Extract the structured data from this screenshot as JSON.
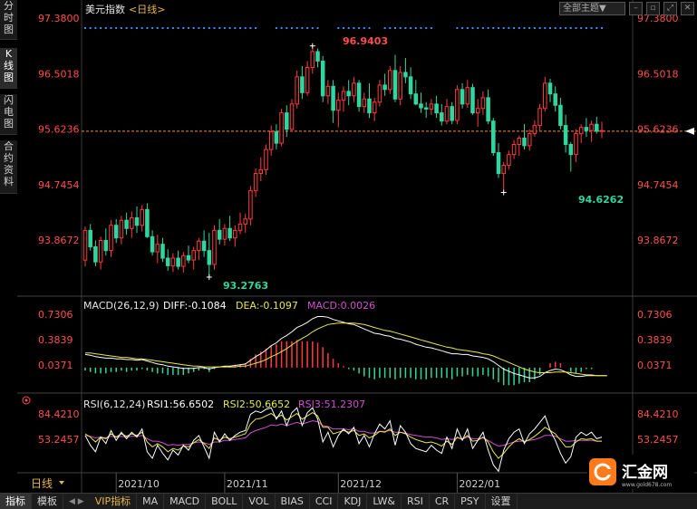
{
  "sidebar_tabs": [
    {
      "label": "分时图"
    },
    {
      "label": "K线图",
      "active": true
    },
    {
      "label": "闪电图"
    },
    {
      "label": "合约资料"
    }
  ],
  "toolbar": {
    "theme": "全部主题▼",
    "icons": [
      "minus-icon",
      "restore-icon",
      "expand-icon",
      "close-icon"
    ]
  },
  "price_panel": {
    "symbol": "美元指数",
    "period_tag": "<日线>",
    "axis_labels": [
      "97.3800",
      "96.5018",
      "95.6236",
      "94.7454",
      "93.8672"
    ],
    "ref_level": 95.59,
    "annotations": {
      "high": "96.9403",
      "low": "93.2763",
      "recent_low": "94.6262"
    }
  },
  "macd_panel": {
    "title": "MACD(26,12,9)",
    "diff": "DIFF:-0.1084",
    "dea": "DEA:-0.1097",
    "macd": "MACD:0.0026",
    "axis_labels": [
      "0.7306",
      "0.3839",
      "0.0371"
    ]
  },
  "rsi_panel": {
    "title": "RSI(6,12,24)",
    "rsi1": "RSI1:56.6502",
    "rsi2": "RSI2:50.6652",
    "rsi3": "RSI3:51.2307",
    "axis_labels": [
      "84.4210",
      "53.2457"
    ]
  },
  "x_axis": {
    "period_label": "日线",
    "labels": [
      "2021/10",
      "2021/11",
      "2021/12",
      "2022/01"
    ]
  },
  "bottom_tabs": [
    "指标",
    "模板",
    "VIP指标",
    "MA",
    "MACD",
    "BOLL",
    "VOL",
    "BIAS",
    "CCI",
    "KDJ",
    "LW&",
    "RSI",
    "CR",
    "PSY",
    "设置"
  ],
  "logo": {
    "text": "汇金网",
    "url": "www.gold678.com"
  },
  "colors": {
    "up": "#ff3b3b",
    "down": "#2fd6a0",
    "axis_text": "#ff4d4d",
    "diff": "#ffffff",
    "dea": "#e8e84a",
    "macd_text": "#d050d0",
    "rsi1": "#ffffff",
    "rsi2": "#e8e84a",
    "rsi3": "#d050d0",
    "ref_line": "#ff8c2a"
  },
  "chart_data": {
    "type": "candlestick",
    "title": "美元指数 <日线>",
    "ylim": [
      93.27,
      97.38
    ],
    "dates": [
      "2021/09/23",
      "2021/09/24",
      "2021/09/27",
      "2021/09/28",
      "2021/09/29",
      "2021/09/30",
      "2021/10/01",
      "2021/10/04",
      "2021/10/05",
      "2021/10/06",
      "2021/10/07",
      "2021/10/08",
      "2021/10/11",
      "2021/10/12",
      "2021/10/13",
      "2021/10/14",
      "2021/10/15",
      "2021/10/18",
      "2021/10/19",
      "2021/10/20",
      "2021/10/21",
      "2021/10/22",
      "2021/10/25",
      "2021/10/26",
      "2021/10/27",
      "2021/10/28",
      "2021/10/29",
      "2021/11/01",
      "2021/11/02",
      "2021/11/03",
      "2021/11/04",
      "2021/11/05",
      "2021/11/08",
      "2021/11/09",
      "2021/11/10",
      "2021/11/11",
      "2021/11/12",
      "2021/11/15",
      "2021/11/16",
      "2021/11/17",
      "2021/11/18",
      "2021/11/19",
      "2021/11/22",
      "2021/11/23",
      "2021/11/24",
      "2021/11/25",
      "2021/11/26",
      "2021/11/29",
      "2021/11/30",
      "2021/12/01",
      "2021/12/02",
      "2021/12/03",
      "2021/12/06",
      "2021/12/07",
      "2021/12/08",
      "2021/12/09",
      "2021/12/10",
      "2021/12/13",
      "2021/12/14",
      "2021/12/15",
      "2021/12/16",
      "2021/12/17",
      "2021/12/20",
      "2021/12/21",
      "2021/12/22",
      "2021/12/23",
      "2021/12/24",
      "2021/12/27",
      "2021/12/28",
      "2021/12/29",
      "2021/12/30",
      "2021/12/31",
      "2022/01/03",
      "2022/01/04",
      "2022/01/05",
      "2022/01/06",
      "2022/01/07",
      "2022/01/10",
      "2022/01/11",
      "2022/01/12",
      "2022/01/13",
      "2022/01/14",
      "2022/01/17",
      "2022/01/18",
      "2022/01/19",
      "2022/01/20",
      "2022/01/21",
      "2022/01/24",
      "2022/01/25",
      "2022/01/26",
      "2022/01/27",
      "2022/01/28",
      "2022/01/31",
      "2022/02/01",
      "2022/02/02",
      "2022/02/03",
      "2022/02/04",
      "2022/02/07",
      "2022/02/08",
      "2022/02/09",
      "2022/02/10",
      "2022/02/11"
    ],
    "ohlc": [
      [
        93.55,
        94.08,
        93.45,
        94.02
      ],
      [
        94.02,
        94.12,
        93.7,
        93.76
      ],
      [
        93.76,
        93.86,
        93.45,
        93.52
      ],
      [
        93.52,
        93.92,
        93.4,
        93.86
      ],
      [
        93.86,
        94.05,
        93.62,
        93.7
      ],
      [
        93.7,
        94.18,
        93.6,
        94.1
      ],
      [
        94.1,
        94.2,
        93.82,
        93.9
      ],
      [
        93.9,
        94.25,
        93.8,
        94.18
      ],
      [
        94.18,
        94.3,
        93.95,
        94.05
      ],
      [
        94.05,
        94.32,
        93.9,
        94.22
      ],
      [
        94.22,
        94.4,
        93.98,
        94.1
      ],
      [
        94.1,
        94.42,
        94.0,
        94.35
      ],
      [
        94.35,
        94.45,
        93.9,
        93.92
      ],
      [
        93.92,
        94.02,
        93.62,
        93.68
      ],
      [
        93.68,
        93.95,
        93.5,
        93.8
      ],
      [
        93.8,
        93.9,
        93.52,
        93.58
      ],
      [
        93.58,
        93.72,
        93.38,
        93.46
      ],
      [
        93.46,
        93.66,
        93.36,
        93.58
      ],
      [
        93.58,
        93.7,
        93.4,
        93.45
      ],
      [
        93.45,
        93.68,
        93.35,
        93.62
      ],
      [
        93.62,
        93.78,
        93.5,
        93.55
      ],
      [
        93.55,
        93.76,
        93.4,
        93.7
      ],
      [
        93.7,
        93.9,
        93.55,
        93.85
      ],
      [
        93.85,
        94.02,
        93.6,
        93.7
      ],
      [
        93.7,
        93.98,
        93.28,
        93.48
      ],
      [
        93.48,
        94.1,
        93.4,
        94.02
      ],
      [
        94.02,
        94.2,
        93.8,
        93.88
      ],
      [
        93.88,
        94.12,
        93.78,
        94.05
      ],
      [
        94.05,
        94.25,
        93.85,
        93.9
      ],
      [
        93.9,
        94.1,
        93.76,
        94.02
      ],
      [
        94.02,
        94.3,
        93.96,
        94.12
      ],
      [
        94.12,
        94.28,
        93.98,
        94.2
      ],
      [
        94.2,
        94.72,
        94.1,
        94.65
      ],
      [
        94.65,
        95.0,
        94.55,
        94.92
      ],
      [
        94.92,
        95.18,
        94.8,
        94.98
      ],
      [
        94.98,
        95.38,
        94.9,
        95.3
      ],
      [
        95.3,
        95.68,
        95.2,
        95.58
      ],
      [
        95.58,
        95.7,
        95.3,
        95.4
      ],
      [
        95.4,
        95.95,
        95.35,
        95.88
      ],
      [
        95.88,
        96.0,
        95.5,
        95.62
      ],
      [
        95.62,
        96.1,
        95.58,
        96.02
      ],
      [
        96.02,
        96.55,
        95.95,
        96.45
      ],
      [
        96.45,
        96.62,
        96.1,
        96.2
      ],
      [
        96.2,
        96.7,
        96.15,
        96.6
      ],
      [
        96.6,
        96.94,
        96.5,
        96.85
      ],
      [
        96.85,
        96.9,
        96.6,
        96.7
      ],
      [
        96.7,
        96.78,
        96.05,
        96.15
      ],
      [
        96.15,
        96.4,
        96.02,
        96.3
      ],
      [
        96.3,
        96.4,
        95.72,
        95.92
      ],
      [
        95.92,
        96.2,
        95.65,
        96.08
      ],
      [
        96.08,
        96.3,
        95.9,
        96.22
      ],
      [
        96.22,
        96.4,
        96.0,
        96.15
      ],
      [
        96.15,
        96.45,
        96.05,
        96.35
      ],
      [
        96.35,
        96.4,
        95.9,
        95.98
      ],
      [
        95.98,
        96.2,
        95.88,
        96.1
      ],
      [
        96.1,
        96.35,
        95.8,
        95.88
      ],
      [
        95.88,
        96.12,
        95.75,
        96.05
      ],
      [
        96.05,
        96.4,
        95.98,
        96.32
      ],
      [
        96.32,
        96.5,
        96.15,
        96.25
      ],
      [
        96.25,
        96.62,
        96.18,
        96.55
      ],
      [
        96.55,
        96.8,
        96.05,
        96.1
      ],
      [
        96.1,
        96.62,
        96.0,
        96.52
      ],
      [
        96.52,
        96.75,
        96.35,
        96.45
      ],
      [
        96.45,
        96.6,
        96.1,
        96.18
      ],
      [
        96.18,
        96.4,
        96.0,
        96.02
      ],
      [
        96.02,
        96.2,
        95.88,
        95.96
      ],
      [
        95.96,
        96.05,
        95.8,
        95.94
      ],
      [
        95.94,
        96.1,
        95.85,
        96.02
      ],
      [
        96.02,
        96.15,
        95.8,
        95.88
      ],
      [
        95.88,
        96.02,
        95.68,
        95.75
      ],
      [
        95.75,
        96.1,
        95.7,
        95.98
      ],
      [
        95.98,
        96.05,
        95.7,
        95.76
      ],
      [
        95.76,
        96.32,
        95.7,
        96.25
      ],
      [
        96.25,
        96.35,
        95.95,
        96.02
      ],
      [
        96.02,
        96.4,
        95.96,
        96.28
      ],
      [
        96.28,
        96.34,
        95.85,
        95.88
      ],
      [
        95.88,
        96.1,
        95.66,
        95.95
      ],
      [
        95.95,
        96.22,
        95.85,
        96.12
      ],
      [
        96.12,
        96.25,
        95.7,
        95.75
      ],
      [
        95.75,
        95.8,
        95.2,
        95.25
      ],
      [
        95.25,
        95.4,
        94.85,
        94.92
      ],
      [
        94.92,
        95.1,
        94.62,
        95.05
      ],
      [
        95.05,
        95.28,
        94.98,
        95.22
      ],
      [
        95.22,
        95.45,
        95.15,
        95.38
      ],
      [
        95.38,
        95.52,
        95.2,
        95.48
      ],
      [
        95.48,
        95.7,
        95.3,
        95.36
      ],
      [
        95.36,
        95.62,
        95.28,
        95.55
      ],
      [
        95.55,
        95.76,
        95.5,
        95.68
      ],
      [
        95.68,
        96.02,
        95.6,
        95.95
      ],
      [
        95.95,
        96.45,
        95.9,
        96.35
      ],
      [
        96.35,
        96.42,
        96.05,
        96.18
      ],
      [
        96.18,
        96.3,
        95.9,
        96.0
      ],
      [
        96.0,
        96.12,
        95.62,
        95.68
      ],
      [
        95.68,
        95.85,
        95.25,
        95.38
      ],
      [
        95.38,
        95.42,
        94.95,
        95.22
      ],
      [
        95.22,
        95.62,
        95.1,
        95.55
      ],
      [
        95.55,
        95.7,
        95.4,
        95.65
      ],
      [
        95.65,
        95.8,
        95.5,
        95.6
      ],
      [
        95.6,
        95.76,
        95.42,
        95.7
      ],
      [
        95.7,
        95.82,
        95.55,
        95.59
      ],
      [
        95.59,
        95.74,
        95.48,
        95.6
      ]
    ],
    "macd_histogram_estimate": "red bars above zero from Oct through late Nov, green bars below zero from mid-Dec into Feb, near zero at last bar",
    "macd_diff": [
      0.18,
      0.17,
      0.15,
      0.14,
      0.13,
      0.13,
      0.12,
      0.12,
      0.11,
      0.11,
      0.1,
      0.11,
      0.09,
      0.07,
      0.05,
      0.04,
      0.02,
      0.01,
      0.0,
      -0.01,
      -0.01,
      -0.01,
      0.0,
      0.0,
      -0.02,
      0.0,
      0.01,
      0.02,
      0.02,
      0.03,
      0.04,
      0.05,
      0.1,
      0.15,
      0.19,
      0.24,
      0.3,
      0.34,
      0.4,
      0.44,
      0.49,
      0.55,
      0.58,
      0.62,
      0.67,
      0.7,
      0.7,
      0.69,
      0.66,
      0.64,
      0.62,
      0.6,
      0.59,
      0.56,
      0.53,
      0.5,
      0.47,
      0.46,
      0.44,
      0.43,
      0.4,
      0.39,
      0.37,
      0.35,
      0.32,
      0.3,
      0.28,
      0.27,
      0.25,
      0.23,
      0.21,
      0.19,
      0.19,
      0.18,
      0.18,
      0.16,
      0.15,
      0.14,
      0.12,
      0.08,
      0.03,
      -0.02,
      -0.05,
      -0.08,
      -0.1,
      -0.12,
      -0.14,
      -0.14,
      -0.12,
      -0.07,
      -0.04,
      -0.02,
      -0.03,
      -0.06,
      -0.1,
      -0.12,
      -0.12,
      -0.11,
      -0.11,
      -0.11,
      -0.11,
      -0.11
    ],
    "macd_dea": [
      0.2,
      0.2,
      0.19,
      0.18,
      0.17,
      0.16,
      0.15,
      0.14,
      0.14,
      0.13,
      0.12,
      0.12,
      0.11,
      0.1,
      0.09,
      0.08,
      0.07,
      0.06,
      0.05,
      0.04,
      0.03,
      0.02,
      0.02,
      0.01,
      0.01,
      0.01,
      0.01,
      0.01,
      0.01,
      0.01,
      0.02,
      0.02,
      0.04,
      0.06,
      0.08,
      0.11,
      0.15,
      0.18,
      0.22,
      0.26,
      0.31,
      0.36,
      0.4,
      0.44,
      0.49,
      0.53,
      0.56,
      0.59,
      0.6,
      0.61,
      0.61,
      0.61,
      0.61,
      0.6,
      0.59,
      0.57,
      0.55,
      0.53,
      0.51,
      0.5,
      0.48,
      0.46,
      0.44,
      0.42,
      0.4,
      0.38,
      0.36,
      0.34,
      0.32,
      0.3,
      0.28,
      0.27,
      0.25,
      0.24,
      0.23,
      0.22,
      0.21,
      0.19,
      0.18,
      0.16,
      0.13,
      0.1,
      0.07,
      0.04,
      0.01,
      -0.02,
      -0.04,
      -0.06,
      -0.07,
      -0.07,
      -0.07,
      -0.06,
      -0.06,
      -0.06,
      -0.07,
      -0.08,
      -0.09,
      -0.1,
      -0.1,
      -0.11,
      -0.11,
      -0.11
    ],
    "rsi_series": {
      "RSI1": [
        58,
        46,
        38,
        56,
        48,
        64,
        52,
        62,
        54,
        62,
        56,
        66,
        38,
        30,
        46,
        36,
        28,
        40,
        34,
        46,
        40,
        52,
        58,
        44,
        30,
        62,
        50,
        60,
        52,
        58,
        62,
        64,
        84,
        88,
        86,
        90,
        92,
        78,
        88,
        70,
        86,
        92,
        70,
        86,
        92,
        78,
        50,
        62,
        44,
        58,
        66,
        60,
        68,
        48,
        58,
        44,
        60,
        72,
        66,
        76,
        46,
        70,
        62,
        48,
        42,
        40,
        38,
        46,
        40,
        36,
        56,
        42,
        66,
        52,
        66,
        42,
        52,
        62,
        40,
        22,
        14,
        40,
        54,
        62,
        66,
        48,
        60,
        66,
        74,
        82,
        64,
        52,
        36,
        24,
        32,
        56,
        62,
        58,
        62,
        54,
        56
      ],
      "RSI2": [
        60,
        56,
        50,
        56,
        54,
        60,
        56,
        60,
        57,
        60,
        58,
        62,
        50,
        44,
        48,
        44,
        38,
        42,
        40,
        45,
        44,
        49,
        53,
        48,
        42,
        55,
        52,
        56,
        54,
        56,
        58,
        60,
        72,
        78,
        79,
        82,
        85,
        80,
        83,
        77,
        81,
        85,
        78,
        82,
        86,
        82,
        68,
        68,
        60,
        62,
        64,
        62,
        64,
        58,
        60,
        55,
        58,
        63,
        62,
        66,
        58,
        62,
        60,
        56,
        53,
        51,
        49,
        50,
        48,
        45,
        51,
        47,
        56,
        53,
        58,
        51,
        52,
        56,
        50,
        38,
        30,
        36,
        44,
        50,
        54,
        50,
        53,
        57,
        62,
        68,
        64,
        60,
        52,
        44,
        44,
        50,
        54,
        53,
        54,
        51,
        51
      ],
      "RSI3": [
        58,
        57,
        55,
        56,
        55,
        57,
        56,
        57,
        56,
        57,
        57,
        58,
        54,
        51,
        51,
        49,
        46,
        47,
        46,
        47,
        47,
        49,
        50,
        49,
        47,
        50,
        50,
        52,
        52,
        53,
        54,
        55,
        61,
        64,
        66,
        68,
        71,
        70,
        72,
        70,
        72,
        74,
        72,
        74,
        76,
        75,
        70,
        69,
        66,
        66,
        66,
        65,
        66,
        63,
        63,
        61,
        61,
        63,
        63,
        64,
        62,
        62,
        61,
        59,
        58,
        57,
        56,
        56,
        55,
        53,
        54,
        53,
        55,
        54,
        56,
        54,
        54,
        55,
        52,
        48,
        45,
        46,
        48,
        50,
        51,
        51,
        52,
        53,
        55,
        58,
        58,
        57,
        54,
        51,
        51,
        52,
        52,
        52,
        52,
        51,
        51
      ]
    },
    "axes": {
      "xlabels": [
        "2021/10",
        "2021/11",
        "2021/12",
        "2022/01"
      ]
    }
  }
}
